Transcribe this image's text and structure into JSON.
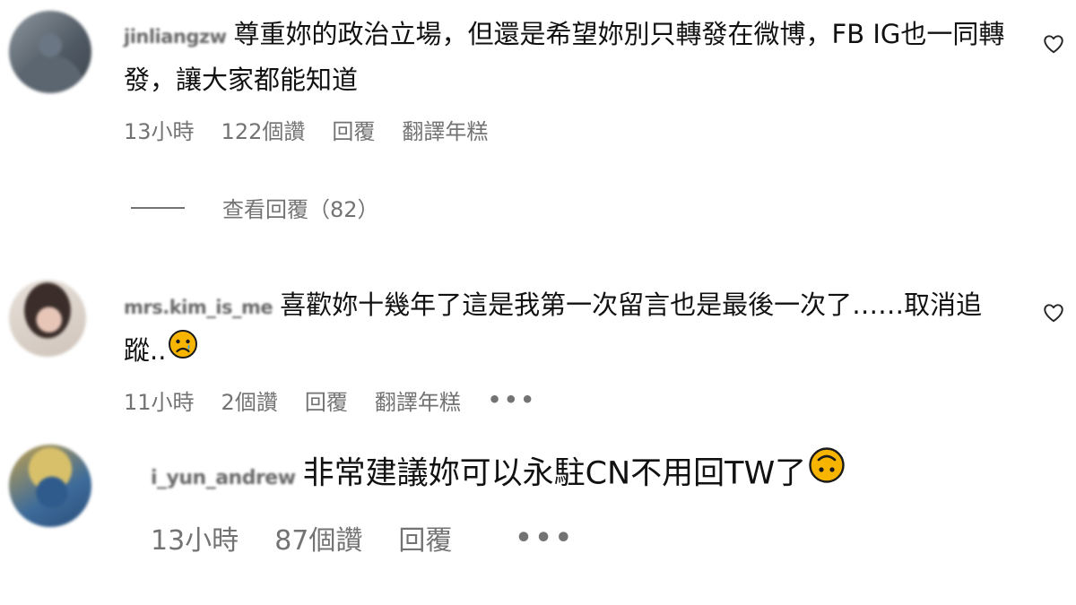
{
  "comments": [
    {
      "username": "jinliangzw",
      "text": "尊重妳的政治立場，但還是希望妳別只轉發在微博，FB IG也一同轉發，讓大家都能知道",
      "time": "13小時",
      "likes": "122個讚",
      "reply_label": "回覆",
      "translate_label": "翻譯年糕",
      "view_replies": "查看回覆（82）"
    },
    {
      "username": "mrs.kim_is_me",
      "text": "喜歡妳十幾年了這是我第一次留言也是最後一次了……取消追蹤..",
      "emoji": "sad-face-emoji",
      "time": "11小時",
      "likes": "2個讚",
      "reply_label": "回覆",
      "translate_label": "翻譯年糕",
      "more": "•••"
    },
    {
      "username": "i_yun_andrew",
      "text": "非常建議妳可以永駐CN不用回TW了",
      "emoji": "upside-down-face-emoji",
      "time": "13小時",
      "likes": "87個讚",
      "reply_label": "回覆",
      "more": "•••"
    }
  ],
  "icons": {
    "like": "heart-outline-icon"
  },
  "colors": {
    "text": "#111111",
    "meta": "#737373",
    "emoji_fill": "#f7b500"
  }
}
